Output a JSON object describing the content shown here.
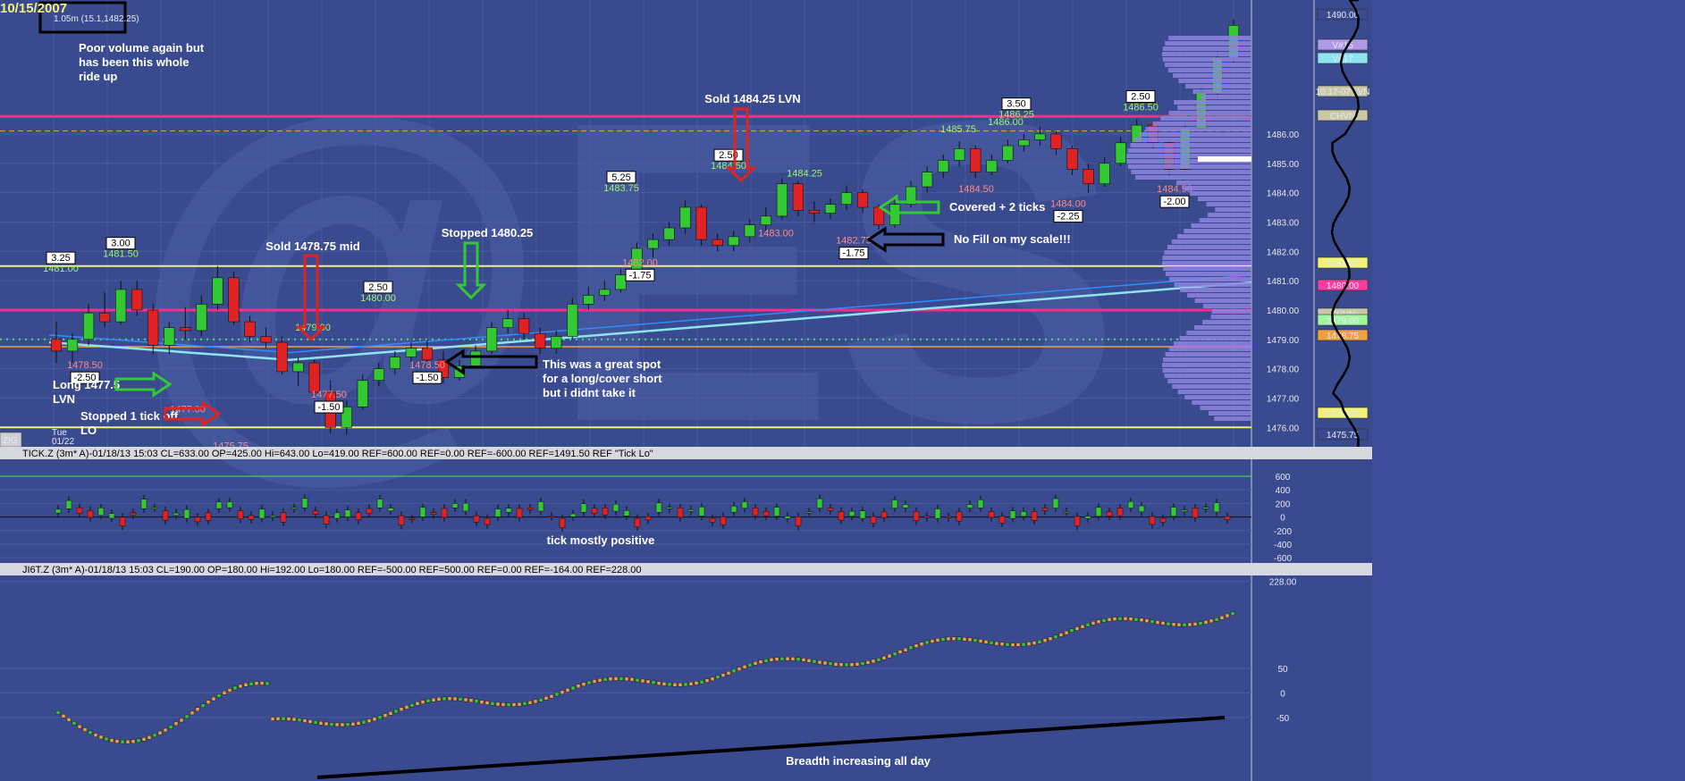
{
  "top_left": {
    "date": "10/15/2007",
    "sub": "1.05m (15.1,1482.25)"
  },
  "panes": {
    "price_header": "",
    "tick_header": "TICK.Z (3m* A)-01/18/13 15:03 CL=633.00 OP=425.00 Hi=643.00 Lo=419.00 REF=600.00 REF=0.00 REF=-600.00 REF=1491.50 REF \"Tick Lo\"",
    "jiii_header": "JI6T.Z (3m* A)-01/18/13 15:03 CL=190.00 OP=180.00 Hi=192.00 Lo=180.00 REF=-500.00 REF=500.00 REF=0.00 REF=-164.00 REF=228.00"
  },
  "annotations": {
    "poor_volume": [
      "Poor volume again but",
      "has been this whole",
      "ride up"
    ],
    "sold_mid": "Sold 1478.75 mid",
    "stopped_1480": "Stopped 1480.25",
    "sold_lvn": "Sold 1484.25 LVN",
    "covered": "Covered + 2 ticks",
    "no_fill": "No Fill on my scale!!!",
    "great_spot": [
      "This was a great spot",
      "for a long/cover short",
      "but i didnt take it"
    ],
    "long_lvn": [
      "Long 1477.5",
      "LVN"
    ],
    "stopped_tick": [
      "Stopped 1 tick off",
      "LO"
    ],
    "tick_positive": "tick mostly positive",
    "breadth": "Breadth increasing all day",
    "zig": "ZIG",
    "date_tue": "Tue",
    "date_0122": "01/22"
  },
  "chart_data": [
    {
      "type": "candlestick",
      "title": "",
      "y_ticks": [
        "1486.00",
        "1485.00",
        "1484.00",
        "1483.00",
        "1482.00",
        "1481.00",
        "1480.00",
        "1479.00",
        "1478.00",
        "1477.00",
        "1476.00"
      ],
      "ylim": [
        1475.4,
        1490.2
      ],
      "swing_labels": [
        {
          "price": "1481.00",
          "diff": "3.25",
          "hi": true
        },
        {
          "price": "1481.50",
          "diff": "3.00",
          "hi": true
        },
        {
          "price": "1478.50",
          "diff": "-2.50",
          "hi": false
        },
        {
          "price": "1477.00",
          "diff": "",
          "hi": false
        },
        {
          "price": "1475.75",
          "diff": "",
          "hi": false
        },
        {
          "price": "1479.00",
          "diff": "",
          "hi": true
        },
        {
          "price": "1477.50",
          "diff": "-1.50",
          "hi": false
        },
        {
          "price": "1480.00",
          "diff": "2.50",
          "hi": true
        },
        {
          "price": "1478.50",
          "diff": "-1.50",
          "hi": false
        },
        {
          "price": "1483.75",
          "diff": "5.25",
          "hi": true
        },
        {
          "price": "1482.00",
          "diff": "-1.75",
          "hi": false
        },
        {
          "price": "1484.50",
          "diff": "2.50",
          "hi": true
        },
        {
          "price": "1483.00",
          "diff": "",
          "hi": false
        },
        {
          "price": "1484.25",
          "diff": "",
          "hi": true
        },
        {
          "price": "1482.75",
          "diff": "-1.75",
          "hi": false
        },
        {
          "price": "1485.75",
          "diff": "",
          "hi": true
        },
        {
          "price": "1484.50",
          "diff": "",
          "hi": false
        },
        {
          "price": "1486.00",
          "diff": "",
          "hi": true
        },
        {
          "price": "1486.25",
          "diff": "3.50",
          "hi": true
        },
        {
          "price": "1484.00",
          "diff": "-2.25",
          "hi": false
        },
        {
          "price": "1486.50",
          "diff": "2.50",
          "hi": true
        },
        {
          "price": "1484.50",
          "diff": "-2.00",
          "hi": false
        }
      ],
      "right_tags": [
        {
          "text": "1490.00",
          "color": "#3a4a8e"
        },
        {
          "text": "V#15",
          "color": "#b09ae8"
        },
        {
          "text": "V#17",
          "color": "#8fe3f0"
        },
        {
          "text": "10.17-07 LVN",
          "color": "#c9c9a8"
        },
        {
          "text": "CHVN",
          "color": "#c9c9a8"
        },
        {
          "text": "1481.50",
          "color": "#f2f27a"
        },
        {
          "text": "1480.00",
          "color": "#ff3aa0"
        },
        {
          "text": "CHVN",
          "color": "#c9c9a8"
        },
        {
          "text": "1479.00",
          "color": "#9ff7a0"
        },
        {
          "text": "1478.75",
          "color": "#f0a040"
        },
        {
          "text": "1476.00",
          "color": "#f2f27a"
        },
        {
          "text": "1475.75",
          "color": "#3a4a8e"
        }
      ],
      "candles": [
        [
          1479.0,
          1479.6,
          1478.2,
          1478.6
        ],
        [
          1478.6,
          1479.2,
          1478.2,
          1479.0
        ],
        [
          1479.0,
          1480.2,
          1478.8,
          1479.9
        ],
        [
          1479.9,
          1480.6,
          1479.4,
          1479.6
        ],
        [
          1479.6,
          1481.0,
          1479.5,
          1480.7
        ],
        [
          1480.7,
          1481.0,
          1479.8,
          1480.0
        ],
        [
          1480.0,
          1480.2,
          1478.5,
          1478.8
        ],
        [
          1478.8,
          1479.6,
          1478.5,
          1479.4
        ],
        [
          1479.4,
          1480.1,
          1479.0,
          1479.3
        ],
        [
          1479.3,
          1480.5,
          1479.1,
          1480.2
        ],
        [
          1480.2,
          1481.5,
          1480.0,
          1481.1
        ],
        [
          1481.1,
          1481.3,
          1479.5,
          1479.6
        ],
        [
          1479.6,
          1479.8,
          1478.9,
          1479.1
        ],
        [
          1479.1,
          1479.4,
          1478.7,
          1478.9
        ],
        [
          1478.9,
          1479.1,
          1477.8,
          1477.9
        ],
        [
          1477.9,
          1478.4,
          1477.4,
          1478.2
        ],
        [
          1478.2,
          1478.3,
          1477.0,
          1477.2
        ],
        [
          1477.2,
          1477.6,
          1475.8,
          1476.0
        ],
        [
          1476.0,
          1476.9,
          1475.75,
          1476.7
        ],
        [
          1476.7,
          1477.8,
          1476.6,
          1477.6
        ],
        [
          1477.6,
          1478.2,
          1477.4,
          1478.0
        ],
        [
          1478.0,
          1478.6,
          1477.8,
          1478.4
        ],
        [
          1478.4,
          1478.9,
          1478.2,
          1478.7
        ],
        [
          1478.7,
          1479.0,
          1478.1,
          1478.3
        ],
        [
          1478.3,
          1478.6,
          1477.5,
          1477.7
        ],
        [
          1477.7,
          1478.3,
          1477.6,
          1478.1
        ],
        [
          1478.1,
          1478.8,
          1478.0,
          1478.6
        ],
        [
          1478.6,
          1479.6,
          1478.5,
          1479.4
        ],
        [
          1479.4,
          1480.0,
          1479.2,
          1479.7
        ],
        [
          1479.7,
          1479.9,
          1479.0,
          1479.2
        ],
        [
          1479.2,
          1479.4,
          1478.5,
          1478.7
        ],
        [
          1478.7,
          1479.3,
          1478.5,
          1479.1
        ],
        [
          1479.1,
          1480.4,
          1479.0,
          1480.2
        ],
        [
          1480.2,
          1480.8,
          1480.0,
          1480.5
        ],
        [
          1480.5,
          1481.0,
          1480.3,
          1480.7
        ],
        [
          1480.7,
          1481.4,
          1480.6,
          1481.2
        ],
        [
          1481.2,
          1482.3,
          1481.0,
          1482.1
        ],
        [
          1482.1,
          1482.6,
          1481.8,
          1482.4
        ],
        [
          1482.4,
          1483.0,
          1482.2,
          1482.8
        ],
        [
          1482.8,
          1483.75,
          1482.6,
          1483.5
        ],
        [
          1483.5,
          1483.6,
          1482.2,
          1482.4
        ],
        [
          1482.4,
          1482.6,
          1482.0,
          1482.2
        ],
        [
          1482.2,
          1482.7,
          1482.0,
          1482.5
        ],
        [
          1482.5,
          1483.1,
          1482.3,
          1482.9
        ],
        [
          1482.9,
          1483.5,
          1482.7,
          1483.2
        ],
        [
          1483.2,
          1484.5,
          1483.1,
          1484.3
        ],
        [
          1484.3,
          1484.4,
          1483.2,
          1483.4
        ],
        [
          1483.4,
          1483.7,
          1483.0,
          1483.3
        ],
        [
          1483.3,
          1483.8,
          1483.1,
          1483.6
        ],
        [
          1483.6,
          1484.25,
          1483.4,
          1484.0
        ],
        [
          1484.0,
          1484.1,
          1483.3,
          1483.5
        ],
        [
          1483.5,
          1483.6,
          1482.75,
          1482.9
        ],
        [
          1482.9,
          1483.8,
          1482.8,
          1483.6
        ],
        [
          1483.6,
          1484.4,
          1483.5,
          1484.2
        ],
        [
          1484.2,
          1484.9,
          1484.0,
          1484.7
        ],
        [
          1484.7,
          1485.3,
          1484.5,
          1485.1
        ],
        [
          1485.1,
          1485.75,
          1484.9,
          1485.5
        ],
        [
          1485.5,
          1485.6,
          1484.5,
          1484.7
        ],
        [
          1484.7,
          1485.3,
          1484.6,
          1485.1
        ],
        [
          1485.1,
          1485.8,
          1485.0,
          1485.6
        ],
        [
          1485.6,
          1486.0,
          1485.4,
          1485.8
        ],
        [
          1485.8,
          1486.25,
          1485.6,
          1486.0
        ],
        [
          1486.0,
          1486.1,
          1485.3,
          1485.5
        ],
        [
          1485.5,
          1485.6,
          1484.6,
          1484.8
        ],
        [
          1484.8,
          1485.0,
          1484.0,
          1484.3
        ],
        [
          1484.3,
          1485.2,
          1484.2,
          1485.0
        ],
        [
          1485.0,
          1485.9,
          1484.9,
          1485.7
        ],
        [
          1485.7,
          1486.5,
          1485.6,
          1486.3
        ],
        [
          1486.3,
          1486.4,
          1485.5,
          1485.7
        ],
        [
          1485.7,
          1485.8,
          1484.5,
          1484.8
        ],
        [
          1484.8,
          1486.4,
          1484.7,
          1486.2
        ],
        [
          1486.2,
          1487.6,
          1486.1,
          1487.4
        ],
        [
          1487.4,
          1488.8,
          1487.2,
          1488.6
        ],
        [
          1488.6,
          1489.9,
          1488.4,
          1489.7
        ]
      ]
    },
    {
      "type": "bar",
      "title": "",
      "y_ticks": [
        "600",
        "400",
        "200",
        "0",
        "-200",
        "-400",
        "-600"
      ],
      "ylim": [
        -650,
        850
      ]
    },
    {
      "type": "line",
      "title": "",
      "y_ticks": [
        "228.00",
        "50",
        "0",
        "-50"
      ],
      "ylim": [
        -180,
        240
      ]
    }
  ]
}
